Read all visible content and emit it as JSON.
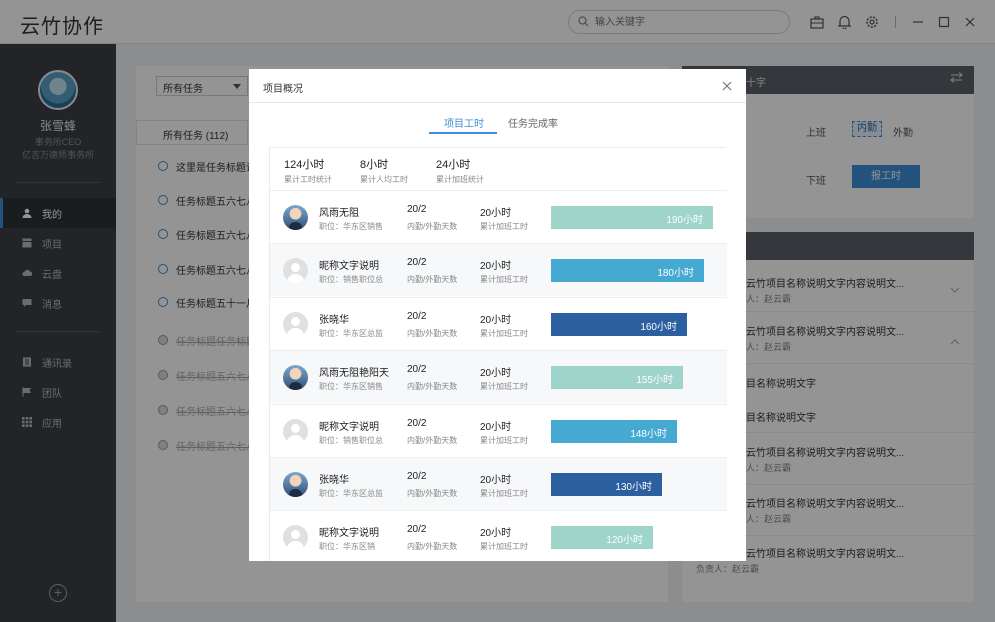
{
  "app": {
    "title": "云竹协作"
  },
  "search": {
    "placeholder": "输入关键字"
  },
  "sidebar": {
    "user": {
      "name": "张雪蜂",
      "role": "事务所CEO",
      "company": "亿吉万德师事务所"
    },
    "nav": [
      {
        "label": "我的",
        "icon": "user-icon",
        "active": true
      },
      {
        "label": "项目",
        "icon": "project-icon",
        "active": false
      },
      {
        "label": "云盘",
        "icon": "cloud-icon",
        "active": false
      },
      {
        "label": "消息",
        "icon": "message-icon",
        "active": false
      },
      {
        "label": "通讯录",
        "icon": "contacts-icon",
        "active": false
      },
      {
        "label": "团队",
        "icon": "flag-icon",
        "active": false
      },
      {
        "label": "应用",
        "icon": "apps-icon",
        "active": false
      }
    ],
    "add_label": "+"
  },
  "background": {
    "filter": "所有任务",
    "tab_all": "所有任务 (112)",
    "tasks": [
      {
        "label": "这里是任务标题说",
        "done": false
      },
      {
        "label": "任务标题五六七八",
        "done": false
      },
      {
        "label": "任务标题五六七八",
        "done": false
      },
      {
        "label": "任务标题五六七八",
        "done": false
      },
      {
        "label": "任务标题五十一月",
        "done": false
      },
      {
        "label": "任务标题任务标题",
        "done": true
      },
      {
        "label": "任务标题五六七八",
        "done": true
      },
      {
        "label": "任务标题五六七八",
        "done": true
      },
      {
        "label": "任务标题五六七八",
        "done": true
      }
    ],
    "attendance": {
      "header": "十字",
      "on_duty": "上班",
      "off_duty": "下班",
      "inner": "内勤",
      "outer": "外勤",
      "report": "报工时"
    },
    "projects": [
      {
        "title": "云竹项目名称说明文字内容说明文...",
        "owner": "人：赵云霸"
      },
      {
        "title": "云竹项目名称说明文字内容说明文...",
        "owner": "人：赵云霸"
      },
      {
        "title": "目名称说明文字",
        "owner": ""
      },
      {
        "title": "目名称说明文字",
        "owner": ""
      },
      {
        "title": "云竹项目名称说明文字内容说明文...",
        "owner": "人：赵云霸"
      },
      {
        "title": "云竹项目名称说明文字内容说明文...",
        "owner": "人：赵云霸"
      },
      {
        "title": "云竹项目名称说明文字内容说明文...",
        "owner": "负责人：赵云霸"
      }
    ]
  },
  "modal": {
    "title": "项目概况",
    "tabs": [
      "项目工时",
      "任务完成率"
    ],
    "summary": [
      {
        "value": "124小时",
        "label": "累计工时统计"
      },
      {
        "value": "8小时",
        "label": "累计人均工时"
      },
      {
        "value": "24小时",
        "label": "累计加班统计"
      }
    ],
    "days_label": "内勤/外勤天数",
    "ot_label": "累计加班工时",
    "members": [
      {
        "name": "风雨无阻",
        "position": "职位：华东区销售",
        "days": "20/2",
        "overtime": "20小时",
        "hours": 190,
        "hours_label": "190小时",
        "photo": true,
        "color": "#9ed4c9"
      },
      {
        "name": "昵称文字说明",
        "position": "职位：销售职位总",
        "days": "20/2",
        "overtime": "20小时",
        "hours": 180,
        "hours_label": "180小时",
        "photo": false,
        "color": "#45a9d1"
      },
      {
        "name": "张晓华",
        "position": "职位：华东区总监",
        "days": "20/2",
        "overtime": "20小时",
        "hours": 160,
        "hours_label": "160小时",
        "photo": false,
        "color": "#2b5fa0"
      },
      {
        "name": "风雨无阻艳阳天",
        "position": "职位：华东区销售",
        "days": "20/2",
        "overtime": "20小时",
        "hours": 155,
        "hours_label": "155小时",
        "photo": true,
        "color": "#9ed4c9"
      },
      {
        "name": "昵称文字说明",
        "position": "职位：销售职位总",
        "days": "20/2",
        "overtime": "20小时",
        "hours": 148,
        "hours_label": "148小时",
        "photo": false,
        "color": "#45a9d1"
      },
      {
        "name": "张晓华",
        "position": "职位：华东区总监",
        "days": "20/2",
        "overtime": "20小时",
        "hours": 130,
        "hours_label": "130小时",
        "photo": true,
        "color": "#2b5fa0"
      },
      {
        "name": "昵称文字说明",
        "position": "职位：华东区销",
        "days": "20/2",
        "overtime": "20小时",
        "hours": 120,
        "hours_label": "120小时",
        "photo": false,
        "color": "#9ed4c9"
      }
    ]
  }
}
